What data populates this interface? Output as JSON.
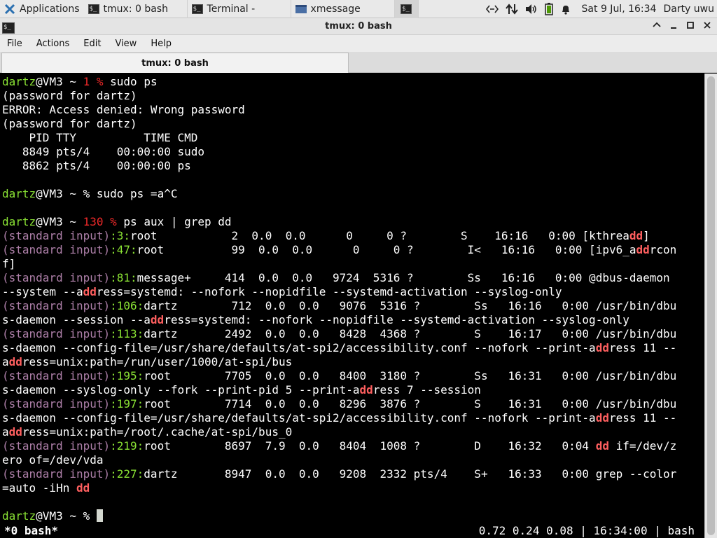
{
  "panel": {
    "applications_label": "Applications",
    "tasks": [
      {
        "label": "tmux: 0 bash",
        "icon": "terminal-icon"
      },
      {
        "label": "Terminal -",
        "icon": "terminal-icon"
      },
      {
        "label": "xmessage",
        "icon": "window-icon"
      }
    ],
    "clock": "Sat  9 Jul, 16:34",
    "user": "Darty uwu",
    "tray_icons": [
      "network-icon",
      "transfer-icon",
      "volume-icon",
      "battery-icon",
      "notification-bell-icon"
    ]
  },
  "window": {
    "title": "tmux: 0 bash",
    "controls": [
      "minimize",
      "maximize",
      "close"
    ]
  },
  "menu": [
    "File",
    "Actions",
    "Edit",
    "View",
    "Help"
  ],
  "tab": {
    "label": "tmux: 0 bash"
  },
  "colors": {
    "prompt_user": "#8ae234",
    "exit_code": "#ef2929",
    "grep_label": "#ad7fa8",
    "grep_match": "#ff5f5f",
    "terminal_bg": "#000000"
  },
  "terminal": {
    "lines": [
      [
        [
          "g",
          "dartz"
        ],
        [
          "",
          "@VM3 ~ "
        ],
        [
          "r",
          "1 %"
        ],
        [
          "",
          " sudo ps"
        ]
      ],
      [
        [
          "",
          "(password for dartz)"
        ]
      ],
      [
        [
          "",
          "ERROR: Access denied: Wrong password"
        ]
      ],
      [
        [
          "",
          "(password for dartz)"
        ]
      ],
      [
        [
          "",
          "    PID TTY          TIME CMD"
        ]
      ],
      [
        [
          "",
          "   8849 pts/4    00:00:00 sudo"
        ]
      ],
      [
        [
          "",
          "   8862 pts/4    00:00:00 ps"
        ]
      ],
      [],
      [
        [
          "g",
          "dartz"
        ],
        [
          "",
          "@VM3 ~ % sudo ps =a^C"
        ]
      ],
      [],
      [
        [
          "g",
          "dartz"
        ],
        [
          "",
          "@VM3 ~ "
        ],
        [
          "r",
          "130 %"
        ],
        [
          "",
          " ps aux | grep dd"
        ]
      ],
      [
        [
          "m",
          "(standard input)"
        ],
        [
          "g",
          ":3:"
        ],
        [
          "",
          "root           2  0.0  0.0      0     0 ?        S    16:16   0:00 [kthrea"
        ],
        [
          "h",
          "dd"
        ],
        [
          "",
          "]"
        ]
      ],
      [
        [
          "m",
          "(standard input)"
        ],
        [
          "g",
          ":47:"
        ],
        [
          "",
          "root          99  0.0  0.0      0     0 ?        I<   16:16   0:00 [ipv6_a"
        ],
        [
          "h",
          "dd"
        ],
        [
          "",
          "rcon"
        ]
      ],
      [
        [
          "",
          "f]"
        ]
      ],
      [
        [
          "m",
          "(standard input)"
        ],
        [
          "g",
          ":81:"
        ],
        [
          "",
          "message+     414  0.0  0.0   9724  5316 ?        Ss   16:16   0:00 @dbus-daemon"
        ]
      ],
      [
        [
          "",
          "--system --a"
        ],
        [
          "h",
          "dd"
        ],
        [
          "",
          "ress=systemd: --nofork --nopidfile --systemd-activation --syslog-only"
        ]
      ],
      [
        [
          "m",
          "(standard input)"
        ],
        [
          "g",
          ":106:"
        ],
        [
          "",
          "dartz        712  0.0  0.0   9076  5316 ?        Ss   16:16   0:00 /usr/bin/dbu"
        ]
      ],
      [
        [
          "",
          "s-daemon --session --a"
        ],
        [
          "h",
          "dd"
        ],
        [
          "",
          "ress=systemd: --nofork --nopidfile --systemd-activation --syslog-only"
        ]
      ],
      [
        [
          "m",
          "(standard input)"
        ],
        [
          "g",
          ":113:"
        ],
        [
          "",
          "dartz       2492  0.0  0.0   8428  4368 ?        S    16:17   0:00 /usr/bin/dbu"
        ]
      ],
      [
        [
          "",
          "s-daemon --config-file=/usr/share/defaults/at-spi2/accessibility.conf --nofork --print-a"
        ],
        [
          "h",
          "dd"
        ],
        [
          "",
          "ress 11 --"
        ]
      ],
      [
        [
          "",
          "a"
        ],
        [
          "h",
          "dd"
        ],
        [
          "",
          "ress=unix:path=/run/user/1000/at-spi/bus"
        ]
      ],
      [
        [
          "m",
          "(standard input)"
        ],
        [
          "g",
          ":195:"
        ],
        [
          "",
          "root        7705  0.0  0.0   8400  3180 ?        Ss   16:31   0:00 /usr/bin/dbu"
        ]
      ],
      [
        [
          "",
          "s-daemon --syslog-only --fork --print-pid 5 --print-a"
        ],
        [
          "h",
          "dd"
        ],
        [
          "",
          "ress 7 --session"
        ]
      ],
      [
        [
          "m",
          "(standard input)"
        ],
        [
          "g",
          ":197:"
        ],
        [
          "",
          "root        7714  0.0  0.0   8296  3876 ?        S    16:31   0:00 /usr/bin/dbu"
        ]
      ],
      [
        [
          "",
          "s-daemon --config-file=/usr/share/defaults/at-spi2/accessibility.conf --nofork --print-a"
        ],
        [
          "h",
          "dd"
        ],
        [
          "",
          "ress 11 --"
        ]
      ],
      [
        [
          "",
          "a"
        ],
        [
          "h",
          "dd"
        ],
        [
          "",
          "ress=unix:path=/root/.cache/at-spi/bus_0"
        ]
      ],
      [
        [
          "m",
          "(standard input)"
        ],
        [
          "g",
          ":219:"
        ],
        [
          "",
          "root        8697  7.9  0.0   8404  1008 ?        D    16:32   0:04 "
        ],
        [
          "h",
          "dd"
        ],
        [
          "",
          " if=/dev/z"
        ]
      ],
      [
        [
          "",
          "ero of=/dev/vda"
        ]
      ],
      [
        [
          "m",
          "(standard input)"
        ],
        [
          "g",
          ":227:"
        ],
        [
          "",
          "dartz       8947  0.0  0.0   9208  2332 pts/4    S+   16:33   0:00 grep --color"
        ]
      ],
      [
        [
          "",
          "=auto -iHn "
        ],
        [
          "h",
          "dd"
        ]
      ],
      [],
      [
        [
          "g",
          "dartz"
        ],
        [
          "",
          "@VM3 ~ % "
        ]
      ]
    ]
  },
  "tmux_status": {
    "left": "*0 bash*",
    "right": "0.72 0.24 0.08 | 16:34:00 | bash"
  }
}
